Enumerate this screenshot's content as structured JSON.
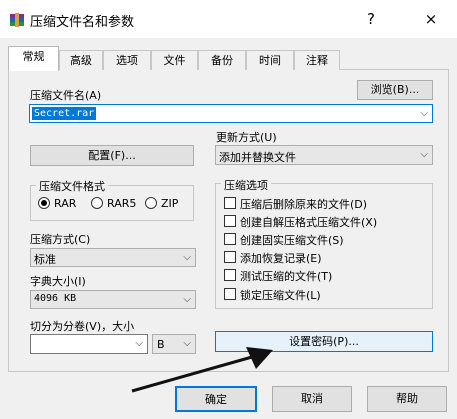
{
  "window": {
    "title": "压缩文件名和参数",
    "help": "?",
    "close": "×"
  },
  "tabs": [
    "常规",
    "高级",
    "选项",
    "文件",
    "备份",
    "时间",
    "注释"
  ],
  "archive_name": {
    "label": "压缩文件名(A)",
    "value": "Secret.rar",
    "browse_label": "浏览(B)..."
  },
  "update_mode": {
    "label": "更新方式(U)",
    "value": "添加并替换文件"
  },
  "profile_button": "配置(F)...",
  "format": {
    "label": "压缩文件格式",
    "options": [
      "RAR",
      "RAR5",
      "ZIP"
    ],
    "selected": "RAR"
  },
  "compression_method": {
    "label": "压缩方式(C)",
    "value": "标准"
  },
  "dictionary": {
    "label": "字典大小(I)",
    "value": "4096 KB"
  },
  "split": {
    "label": "切分为分卷(V)，大小",
    "value": "",
    "unit": "B"
  },
  "options": {
    "label": "压缩选项",
    "items": [
      {
        "label": "压缩后删除原来的文件(D)",
        "checked": false
      },
      {
        "label": "创建自解压格式压缩文件(X)",
        "checked": false
      },
      {
        "label": "创建固实压缩文件(S)",
        "checked": false
      },
      {
        "label": "添加恢复记录(E)",
        "checked": false
      },
      {
        "label": "测试压缩的文件(T)",
        "checked": false
      },
      {
        "label": "锁定压缩文件(L)",
        "checked": false
      }
    ]
  },
  "password_button": "设置密码(P)...",
  "footer": {
    "ok": "确定",
    "cancel": "取消",
    "help": "帮助"
  }
}
